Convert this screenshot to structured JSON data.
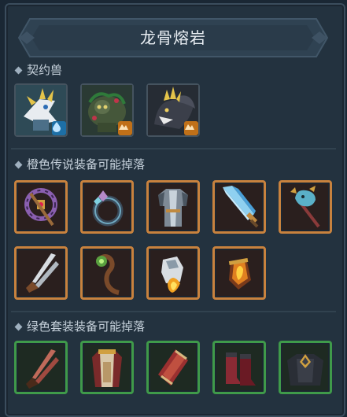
{
  "title": "龙骨熔岩",
  "sections": {
    "pets": {
      "label": "契约兽"
    },
    "orange": {
      "label": "橙色传说装备可能掉落"
    },
    "green": {
      "label": "绿色套装装备可能掉落"
    }
  },
  "pets": [
    {
      "name": "pet-white-dragon",
      "element": "water",
      "element_icon": "water-drop-icon"
    },
    {
      "name": "pet-moss-beast",
      "element": "earth",
      "element_icon": "mountain-icon"
    },
    {
      "name": "pet-dark-wolf",
      "element": "earth",
      "element_icon": "mountain-icon"
    }
  ],
  "orange_items": [
    {
      "icon": "purple-staff-icon"
    },
    {
      "icon": "ring-icon"
    },
    {
      "icon": "robe-armor-icon"
    },
    {
      "icon": "ice-blade-icon"
    },
    {
      "icon": "bird-scepter-icon"
    },
    {
      "icon": "dual-blade-icon"
    },
    {
      "icon": "wooden-staff-icon"
    },
    {
      "icon": "fire-gauntlet-icon"
    },
    {
      "icon": "flame-bracer-icon"
    }
  ],
  "green_items": [
    {
      "icon": "dual-blade-icon"
    },
    {
      "icon": "cloak-armor-icon"
    },
    {
      "icon": "bracer-icon"
    },
    {
      "icon": "boots-icon"
    },
    {
      "icon": "dark-chestplate-icon"
    }
  ],
  "colors": {
    "orange_border": "#c8823e",
    "green_border": "#3f9a4a",
    "water_badge": "#1d6fa6",
    "earth_badge": "#c07018"
  }
}
